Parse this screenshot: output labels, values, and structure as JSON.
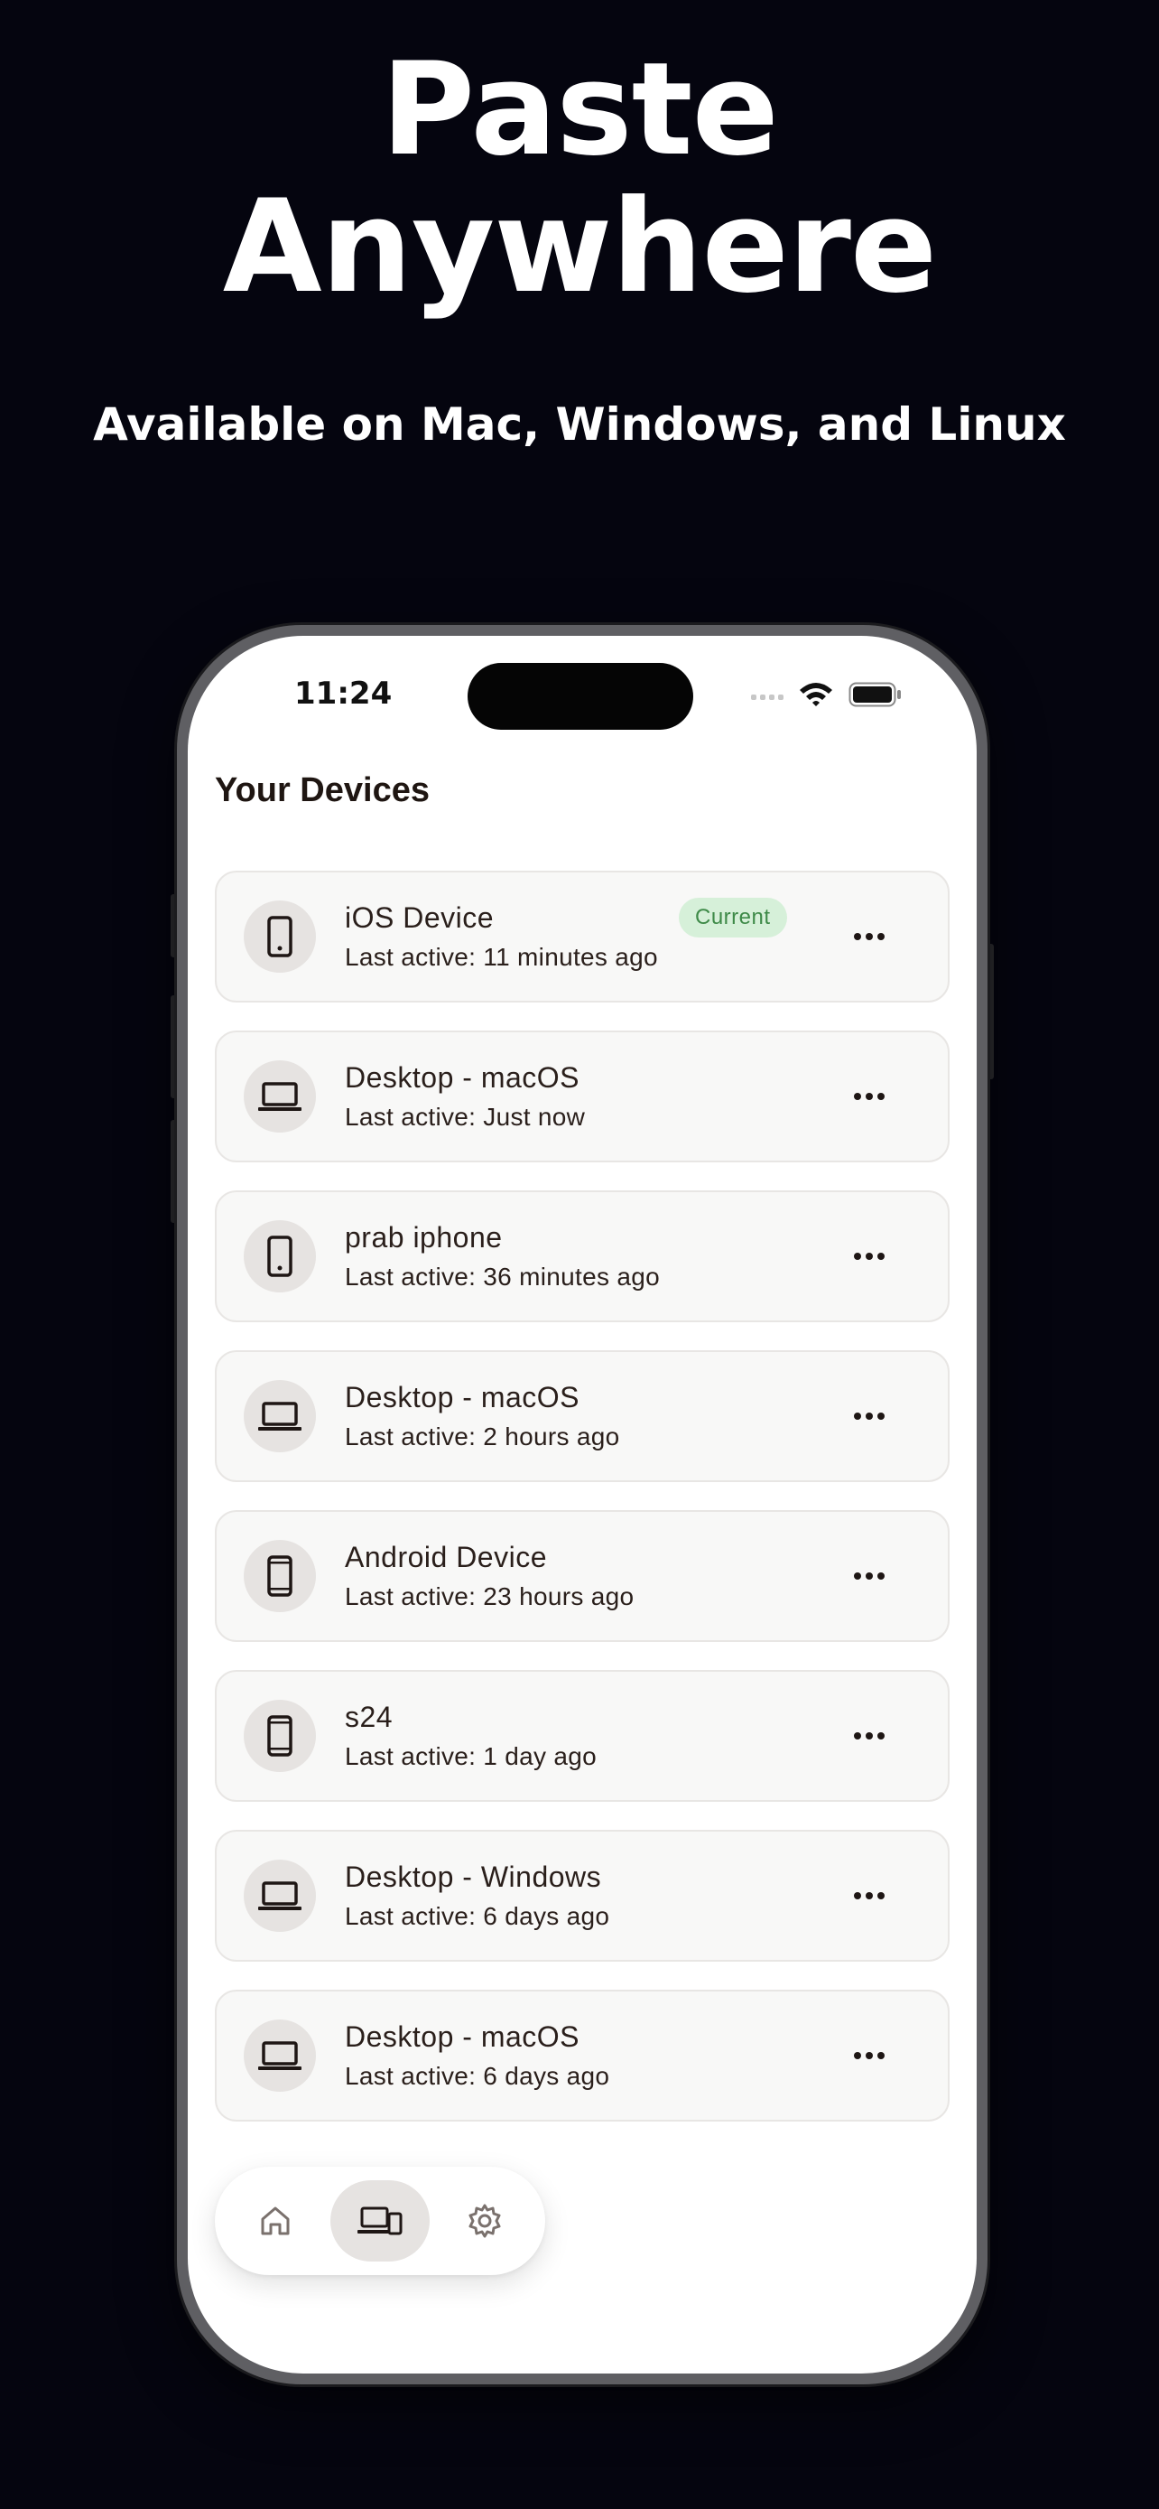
{
  "hero": {
    "title_line1": "Paste",
    "title_line2": "Anywhere",
    "subtitle": "Available on Mac, Windows, and Linux"
  },
  "status_bar": {
    "time": "11:24",
    "icons": [
      "signal-icon",
      "wifi-icon",
      "battery-icon"
    ]
  },
  "screen": {
    "title": "Your Devices"
  },
  "devices": [
    {
      "name": "iOS Device",
      "last_active": "Last active: 11 minutes ago",
      "icon": "phone-icon",
      "badge": "Current"
    },
    {
      "name": "Desktop - macOS",
      "last_active": "Last active: Just now",
      "icon": "laptop-icon"
    },
    {
      "name": "prab iphone",
      "last_active": "Last active: 36 minutes ago",
      "icon": "phone-icon"
    },
    {
      "name": "Desktop - macOS",
      "last_active": "Last active: 2 hours ago",
      "icon": "laptop-icon"
    },
    {
      "name": "Android Device",
      "last_active": "Last active: 23 hours ago",
      "icon": "phone-icon"
    },
    {
      "name": "s24",
      "last_active": "Last active: 1 day ago",
      "icon": "phone-icon"
    },
    {
      "name": "Desktop - Windows",
      "last_active": "Last active: 6 days ago",
      "icon": "laptop-icon"
    },
    {
      "name": "Desktop - macOS",
      "last_active": "Last active: 6 days ago",
      "icon": "laptop-icon"
    }
  ],
  "tab_bar": {
    "tabs": [
      {
        "icon": "home-icon",
        "active": false
      },
      {
        "icon": "devices-icon",
        "active": true
      },
      {
        "icon": "gear-icon",
        "active": false
      }
    ]
  },
  "colors": {
    "background": "#05050f",
    "text_primary": "#2a1f1b",
    "badge_bg": "#d6f0d9",
    "badge_text": "#3e8a48",
    "card_bg": "#f8f8f7",
    "avatar_bg": "#e6e3e1"
  }
}
